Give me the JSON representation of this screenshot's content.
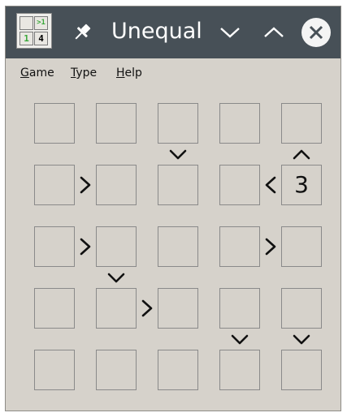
{
  "window": {
    "title": "Unequal",
    "app_icon_cells": [
      "",
      ">1",
      "1",
      "4"
    ],
    "colors": {
      "titlebar": "#475057",
      "background": "#d6d2cb",
      "cell_border": "#8a8a8a",
      "symbol": "#111111",
      "icon_green": "#3aa83a"
    }
  },
  "menu": [
    {
      "label": "Game",
      "accel": "G",
      "rest": "ame"
    },
    {
      "label": "Type",
      "accel": "T",
      "rest": "ype"
    },
    {
      "label": "Help",
      "accel": "H",
      "rest": "elp"
    }
  ],
  "board": {
    "size": 5,
    "cells": [
      [
        "",
        "",
        "",
        "",
        ""
      ],
      [
        "",
        "",
        "",
        "",
        "3"
      ],
      [
        "",
        "",
        "",
        "",
        ""
      ],
      [
        "",
        "",
        "",
        "",
        ""
      ],
      [
        "",
        "",
        "",
        "",
        ""
      ]
    ],
    "horizontal_signs": [
      {
        "row": 1,
        "col": 0,
        "symbol": ">"
      },
      {
        "row": 1,
        "col": 3,
        "symbol": "<"
      },
      {
        "row": 2,
        "col": 0,
        "symbol": ">"
      },
      {
        "row": 2,
        "col": 3,
        "symbol": ">"
      },
      {
        "row": 3,
        "col": 1,
        "symbol": ">"
      }
    ],
    "vertical_signs": [
      {
        "row": 0,
        "col": 2,
        "symbol": "v"
      },
      {
        "row": 0,
        "col": 4,
        "symbol": "^"
      },
      {
        "row": 2,
        "col": 1,
        "symbol": "v"
      },
      {
        "row": 3,
        "col": 3,
        "symbol": "v"
      },
      {
        "row": 3,
        "col": 4,
        "symbol": "v"
      }
    ]
  }
}
